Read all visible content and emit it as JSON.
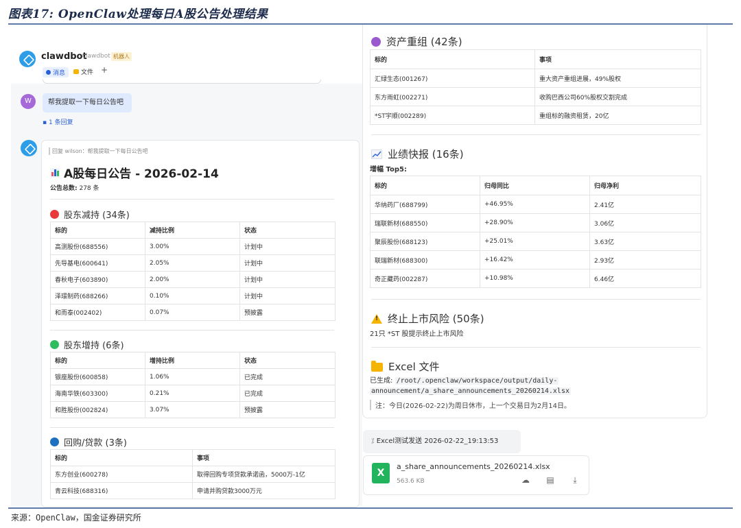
{
  "figure": {
    "title": "图表17: OpenClaw处理每日A股公告处理结果",
    "source": "来源：OpenClaw，国金证券研究所"
  },
  "channel": {
    "name": "clawdbot",
    "sub": "clawdbot",
    "tag": "机器人",
    "tabs": [
      "消息",
      "文件"
    ],
    "plus": "+"
  },
  "user_message": {
    "avatar": "W",
    "text": "帮我提取一下每日公告吧",
    "reply_count": "1 条回复"
  },
  "bot_reply": {
    "quote": "回复 wilson：帮我提取一下每日公告吧",
    "title": "A股每日公告 - 2026-02-14",
    "total_label": "公告总数:",
    "total_value": "278 条",
    "sections": {
      "reduce": {
        "title": "股东减持 (34条)",
        "color": "#e83a3a",
        "headers": [
          "标的",
          "减持比例",
          "状态"
        ],
        "rows": [
          [
            "高测股份(688556)",
            "3.00%",
            "计划中"
          ],
          [
            "先导基电(600641)",
            "2.05%",
            "计划中"
          ],
          [
            "春秋电子(603890)",
            "2.00%",
            "计划中"
          ],
          [
            "泽璟制药(688266)",
            "0.10%",
            "计划中"
          ],
          [
            "和而泰(002402)",
            "0.07%",
            "预披露"
          ]
        ]
      },
      "increase": {
        "title": "股东增持 (6条)",
        "color": "#2ebc5f",
        "headers": [
          "标的",
          "增持比例",
          "状态"
        ],
        "rows": [
          [
            "银座股份(600858)",
            "1.06%",
            "已完成"
          ],
          [
            "海南华铁(603300)",
            "0.21%",
            "已完成"
          ],
          [
            "和胜股份(002824)",
            "3.07%",
            "预披露"
          ]
        ]
      },
      "buyback": {
        "title": "回购/贷款 (3条)",
        "color": "#1f6fbf",
        "headers": [
          "标的",
          "事项"
        ],
        "rows": [
          [
            "东方创业(600278)",
            "取得回购专项贷款承诺函，5000万-1亿"
          ],
          [
            "青云科技(688316)",
            "申请并购贷款3000万元"
          ]
        ]
      },
      "restructure": {
        "title": "资产重组 (42条)",
        "color": "#9b59d0",
        "headers": [
          "标的",
          "事项"
        ],
        "rows": [
          [
            "汇绿生态(001267)",
            "重大资产重组进展，49%股权"
          ],
          [
            "东方雨虹(002271)",
            "收购巴西公司60%股权交割完成"
          ],
          [
            "*ST宇顺(002289)",
            "重组标的融资租赁，20亿"
          ]
        ]
      },
      "earnings": {
        "title": "业绩快报 (16条)",
        "subtitle": "增幅 Top5:",
        "headers": [
          "标的",
          "归母同比",
          "归母净利"
        ],
        "rows": [
          [
            "华纳药厂(688799)",
            "+46.95%",
            "2.41亿"
          ],
          [
            "瑞联新材(688550)",
            "+28.90%",
            "3.06亿"
          ],
          [
            "聚辰股份(688123)",
            "+25.01%",
            "3.63亿"
          ],
          [
            "联瑞新材(688300)",
            "+16.42%",
            "2.93亿"
          ],
          [
            "奇正藏药(002287)",
            "+10.98%",
            "6.46亿"
          ]
        ]
      },
      "delist": {
        "title": "终止上市风险 (50条)",
        "subtitle": "21只 *ST 股提示终止上市风险"
      },
      "excel": {
        "title": "Excel 文件",
        "generated_label": "已生成:",
        "path_line1": "/root/.openclaw/workspace/output/daily-",
        "path_line2": "announcement/a_share_announcements_20260214.xlsx",
        "note": "注：今日(2026-02-22)为周日休市，上一个交易日为2月14日。"
      }
    }
  },
  "attachment": {
    "send_label": "Excel测试发送 2026-02-22_19:13:53",
    "file_icon": "X",
    "file_name": "a_share_announcements_20260214.xlsx",
    "file_size": "563.6 KB"
  }
}
